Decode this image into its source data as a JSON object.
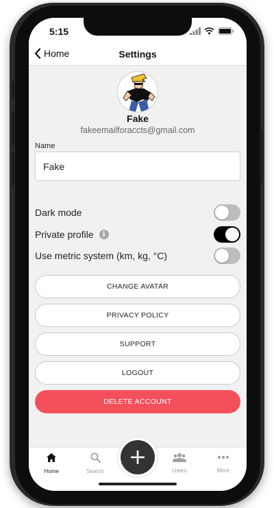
{
  "status_bar": {
    "time": "5:15"
  },
  "nav": {
    "back_label": "Home",
    "title": "Settings"
  },
  "profile": {
    "name": "Fake",
    "email": "fakeemailforaccts@gmail.com",
    "avatar_icon": "cartoon-avatar-image"
  },
  "name_field": {
    "label": "Name",
    "value": "Fake"
  },
  "settings": {
    "dark_mode": {
      "label": "Dark mode",
      "on": false
    },
    "private_profile": {
      "label": "Private profile",
      "on": true
    },
    "metric_system": {
      "label": "Use metric system (km, kg, °C)",
      "on": false
    }
  },
  "actions": {
    "change_avatar": "CHANGE AVATAR",
    "privacy_policy": "PRIVACY POLICY",
    "support": "SUPPORT",
    "logout": "LOGOUT",
    "delete_account": "DELETE ACCOUNT"
  },
  "tab_bar": {
    "home": "Home",
    "search": "Search",
    "users": "Users",
    "more": "More"
  },
  "colors": {
    "danger": "#f4505c",
    "toggle_on": "#000000",
    "toggle_off": "#bdbdbd",
    "fab": "#333333"
  }
}
